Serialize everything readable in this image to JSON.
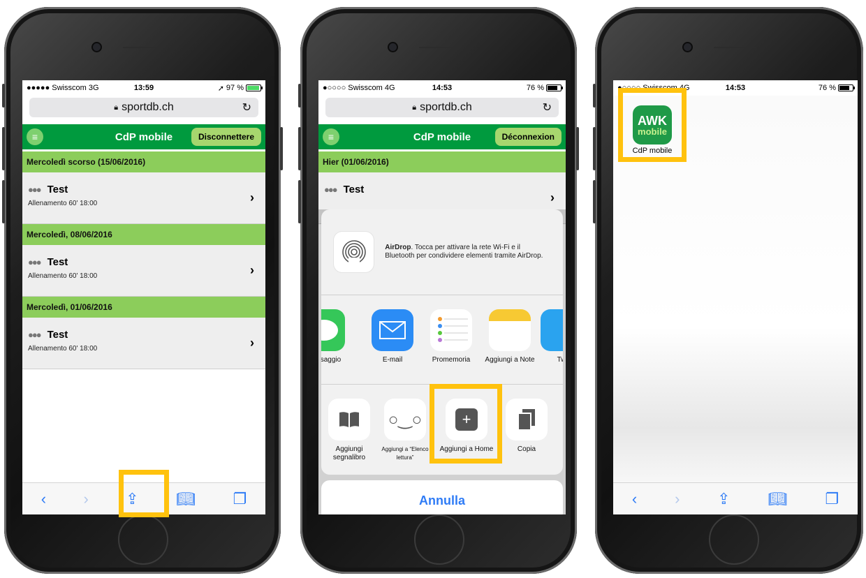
{
  "phone1": {
    "status": {
      "signal": "●●●●● Swisscom",
      "network": "3G",
      "time": "13:59",
      "battery": "97 %"
    },
    "url": "sportdb.ch",
    "header": {
      "title": "CdP mobile",
      "logout": "Disconnettere"
    },
    "sections": [
      {
        "label": "Mercoledì scorso (15/06/2016)",
        "item": {
          "title": "Test",
          "subtitle": "Allenamento 60' 18:00"
        }
      },
      {
        "label": "Mercoledì, 08/06/2016",
        "item": {
          "title": "Test",
          "subtitle": "Allenamento 60' 18:00"
        }
      },
      {
        "label": "Mercoledì, 01/06/2016",
        "item": {
          "title": "Test",
          "subtitle": "Allenamento 60' 18:00"
        }
      }
    ]
  },
  "phone2": {
    "status": {
      "signal": "●○○○○ Swisscom",
      "network": "4G",
      "time": "14:53",
      "battery": "76 %"
    },
    "url": "sportdb.ch",
    "header": {
      "title": "CdP mobile",
      "logout": "Déconnexion"
    },
    "section": "Hier (01/06/2016)",
    "item_title": "Test",
    "airdrop": {
      "title": "AirDrop",
      "text": ". Tocca per attivare la rete Wi-Fi e il Bluetooth per condividere elementi tramite AirDrop."
    },
    "apps": [
      "Messaggio",
      "E-mail",
      "Promemoria",
      "Aggiungi a Note",
      "Tw"
    ],
    "actions": [
      "Aggiungi segnalibro",
      "Aggiungi a “Elenco lettura”",
      "Aggiungi a Home",
      "Copia"
    ],
    "cancel": "Annulla"
  },
  "phone3": {
    "status": {
      "signal": "●○○○○ Swisscom",
      "network": "4G",
      "time": "14:53",
      "battery": "76 %"
    },
    "app_icon": {
      "line1": "AWK",
      "line2": "mobile",
      "label": "CdP mobile"
    }
  },
  "colors": {
    "highlight": "#ffc20e",
    "green": "#009a3e",
    "light_green": "#8ccd5b",
    "ios_blue": "#2f7cf6"
  },
  "icons": [
    "lock-icon",
    "reload-icon",
    "menu-icon",
    "group-icon",
    "chevron-right-icon",
    "back-icon",
    "forward-icon",
    "share-icon",
    "bookmarks-icon",
    "tabs-icon",
    "airdrop-icon",
    "plus-icon",
    "copy-icon"
  ]
}
